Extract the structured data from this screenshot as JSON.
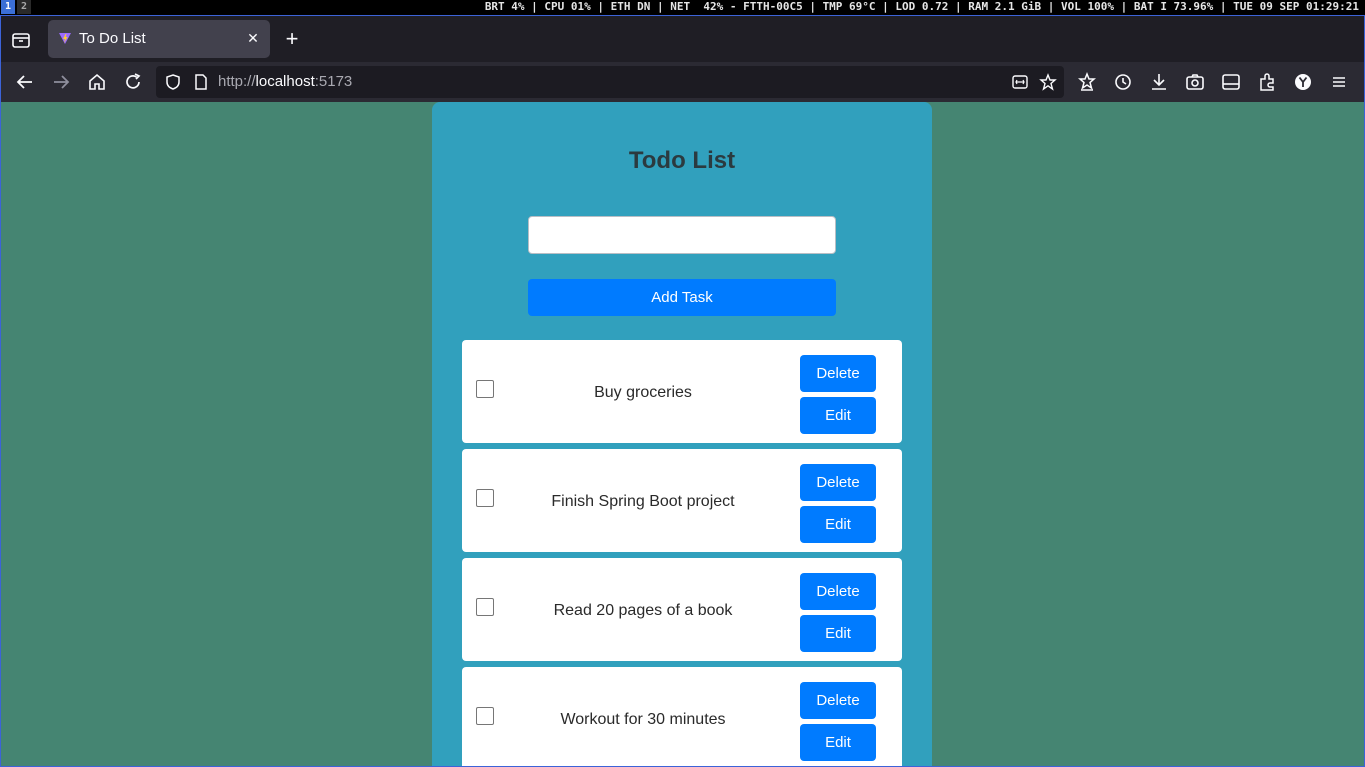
{
  "system_bar": {
    "workspaces": [
      "1",
      "2"
    ],
    "status": "BRT 4% | CPU 01% | ETH DN | NET  42% - FTTH-00C5 | TMP 69°C | LOD 0.72 | RAM 2.1 GiB | VOL 100% | BAT I 73.96% | TUE 09 SEP 01:29:21"
  },
  "browser": {
    "tab": {
      "title": "To Do List"
    },
    "url": {
      "scheme": "http://",
      "host": "localhost",
      "port": ":5173"
    }
  },
  "page": {
    "title": "Todo List",
    "input": {
      "value": "",
      "placeholder": ""
    },
    "add_button": "Add Task",
    "todos": [
      {
        "text": "Buy groceries",
        "checked": false,
        "delete_label": "Delete",
        "edit_label": "Edit"
      },
      {
        "text": "Finish Spring Boot project",
        "checked": false,
        "delete_label": "Delete",
        "edit_label": "Edit"
      },
      {
        "text": "Read 20 pages of a book",
        "checked": false,
        "delete_label": "Delete",
        "edit_label": "Edit"
      },
      {
        "text": "Workout for 30 minutes",
        "checked": false,
        "delete_label": "Delete",
        "edit_label": "Edit"
      }
    ]
  },
  "colors": {
    "page_background": "#458572",
    "card_background": "#31a0bd",
    "primary_button": "#007bff",
    "active_workspace": "#3b6fd6"
  }
}
